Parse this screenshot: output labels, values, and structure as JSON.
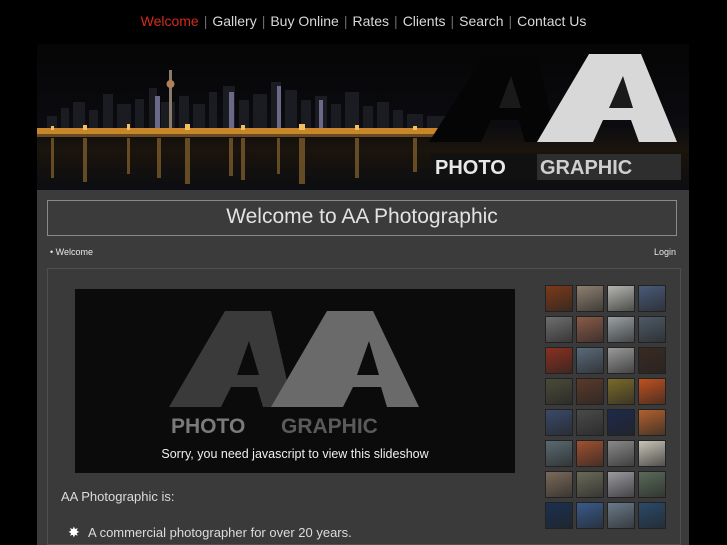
{
  "nav": {
    "items": [
      "Welcome",
      "Gallery",
      "Buy Online",
      "Rates",
      "Clients",
      "Search",
      "Contact Us"
    ],
    "separator": "|",
    "active": "Welcome",
    "active_color": "#d42a1e",
    "text_color": "#d8d8d8"
  },
  "banner": {
    "logo_letters": "AA",
    "logo_word_left": "PHOTO",
    "logo_word_right": "GRAPHIC"
  },
  "page": {
    "title": "Welcome to AA Photographic",
    "breadcrumb": "• Welcome",
    "login": "Login"
  },
  "slideshow": {
    "logo_letters": "AA",
    "logo_word_left": "PHOTO",
    "logo_word_right": "GRAPHIC",
    "message": "Sorry, you need javascript to view this slideshow"
  },
  "body": {
    "intro": "AA Photographic is:",
    "bullets": [
      "A commercial photographer for over 20 years."
    ]
  },
  "thumbnails": {
    "count": 32,
    "colors": [
      "#7a3a1a",
      "#8f8070",
      "#b5b5b0",
      "#4a5a78",
      "#6e6e6e",
      "#8a5a48",
      "#9aa0a4",
      "#4e5a66",
      "#8a3020",
      "#5a6a7a",
      "#9a9a9a",
      "#3a2a22",
      "#4a4a3a",
      "#5a3a2a",
      "#7a6a2a",
      "#c05020",
      "#3a4a6a",
      "#4a4a4a",
      "#1e2a4a",
      "#b06030",
      "#5a6a70",
      "#a05030",
      "#8a8a8a",
      "#c8c4b8",
      "#7a6a5a",
      "#6a6a5a",
      "#9a9aa0",
      "#5a6a5a",
      "#1a3050",
      "#3a5a8a",
      "#6a7a8a",
      "#2a4a6a"
    ]
  }
}
